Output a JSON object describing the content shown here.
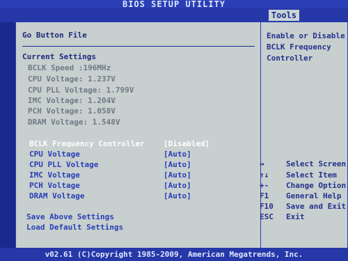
{
  "title": "BIOS SETUP UTILITY",
  "active_tab": "Tools",
  "section_title": "Go Button File",
  "current_settings": {
    "header": "Current Settings",
    "lines": [
      "BCLK Speed  :196MHz",
      "CPU Voltage: 1.237V",
      "CPU PLL Voltage: 1.799V",
      "IMC Voltage: 1.204V",
      "PCH Voltage: 1.058V",
      "DRAM Voltage: 1.548V"
    ]
  },
  "options": [
    {
      "label": "BCLK Frequency Controller",
      "value": "[Disabled]"
    },
    {
      "label": "CPU Voltage",
      "value": "[Auto]"
    },
    {
      "label": "CPU PLL Voltage",
      "value": "[Auto]"
    },
    {
      "label": "IMC Voltage",
      "value": "[Auto]"
    },
    {
      "label": "PCH Voltage",
      "value": "[Auto]"
    },
    {
      "label": "DRAM Voltage",
      "value": "[Auto]"
    }
  ],
  "actions": [
    "Save Above Settings",
    "Load Default Settings"
  ],
  "help_text": [
    "Enable or Disable",
    "BCLK Frequency",
    "Controller"
  ],
  "key_help": [
    {
      "key": "↔",
      "desc": "Select Screen"
    },
    {
      "key": "↑↓",
      "desc": "Select Item"
    },
    {
      "key": "+-",
      "desc": "Change Option"
    },
    {
      "key": "F1",
      "desc": "General Help"
    },
    {
      "key": "F10",
      "desc": "Save and Exit"
    },
    {
      "key": "ESC",
      "desc": "Exit"
    }
  ],
  "footer": "v02.61 (C)Copyright 1985-2009, American Megatrends, Inc."
}
